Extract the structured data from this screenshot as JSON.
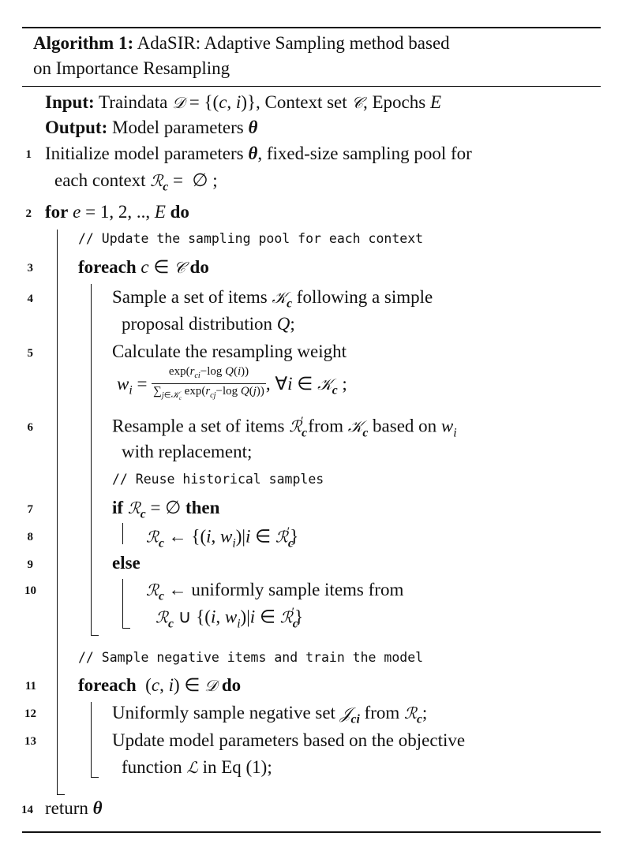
{
  "algorithm": {
    "label": "Algorithm 1:",
    "title_line1": "AdaSIR: Adaptive Sampling method based",
    "title_line2": "on Importance Resampling"
  },
  "io": {
    "input_kw": "Input:",
    "input_text": "Traindata 𝒟 = {(c, i)}, Context set 𝒞, Epochs E",
    "output_kw": "Output:",
    "output_text": "Model parameters θ"
  },
  "lines": [
    {
      "num": "1",
      "text": "Initialize model parameters θ, fixed-size sampling pool for"
    },
    {
      "num": "",
      "text": "each context ℛc = ∅ ;"
    },
    {
      "num": "2",
      "text": "for e = 1, 2, .., E do"
    },
    {
      "num": "",
      "text": "// Update the sampling pool for each context"
    },
    {
      "num": "3",
      "text": "foreach c ∈ 𝒞 do"
    },
    {
      "num": "4",
      "text": "Sample a set of items 𝒦c following a simple"
    },
    {
      "num": "",
      "text": "proposal distribution Q;"
    },
    {
      "num": "5",
      "text": "Calculate the resampling weight"
    },
    {
      "num": "",
      "text": "wi = exp(rci − log Q(i)) / ∑j∈𝒦c exp(rcj − log Q(j)), ∀i ∈ 𝒦c ;"
    },
    {
      "num": "6",
      "text": "Resample a set of items ℛ′c from 𝒦c based on wi"
    },
    {
      "num": "",
      "text": "with replacement;"
    },
    {
      "num": "",
      "text": "// Reuse historical samples"
    },
    {
      "num": "7",
      "text": "if ℛc = ∅ then"
    },
    {
      "num": "8",
      "text": "ℛc ← {(i, wi)|i ∈ ℛ′c}"
    },
    {
      "num": "9",
      "text": "else"
    },
    {
      "num": "10",
      "text": "ℛc ← uniformly sample items from"
    },
    {
      "num": "",
      "text": "ℛc ∪ {(i, wi)|i ∈ ℛ′c}"
    },
    {
      "num": "",
      "text": "// Sample negative items and train the model"
    },
    {
      "num": "11",
      "text": "foreach (c, i) ∈ 𝒟 do"
    },
    {
      "num": "12",
      "text": "Uniformly sample negative set 𝒥ci from ℛc;"
    },
    {
      "num": "13",
      "text": "Update model parameters based on the objective"
    },
    {
      "num": "",
      "text": "function ℒ in Eq (1);"
    },
    {
      "num": "14",
      "text": "return θ"
    }
  ]
}
